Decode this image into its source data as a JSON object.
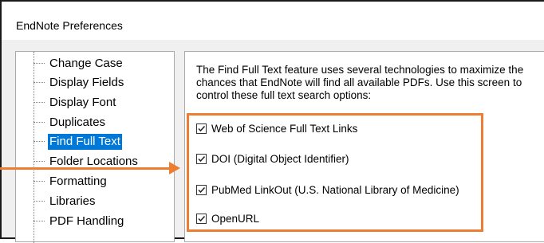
{
  "window": {
    "title": "EndNote Preferences"
  },
  "sidebar": {
    "items": [
      {
        "label": "Change Case",
        "selected": false
      },
      {
        "label": "Display Fields",
        "selected": false
      },
      {
        "label": "Display Font",
        "selected": false
      },
      {
        "label": "Duplicates",
        "selected": false
      },
      {
        "label": "Find Full Text",
        "selected": true
      },
      {
        "label": "Folder Locations",
        "selected": false
      },
      {
        "label": "Formatting",
        "selected": false
      },
      {
        "label": "Libraries",
        "selected": false
      },
      {
        "label": "PDF Handling",
        "selected": false
      }
    ]
  },
  "content": {
    "description_lines": [
      "The Find Full Text feature uses several technologies to maximize the",
      "chances that EndNote will find all available PDFs. Use this screen to",
      "control these full text search options:"
    ],
    "options": [
      {
        "label": "Web of Science Full Text Links",
        "checked": true
      },
      {
        "label": "DOI (Digital Object Identifier)",
        "checked": true
      },
      {
        "label": "PubMed LinkOut (U.S. National Library of Medicine)",
        "checked": true
      },
      {
        "label": "OpenURL",
        "checked": true
      }
    ]
  },
  "colors": {
    "selection": "#0078d7",
    "annotation": "#ed7d31"
  }
}
